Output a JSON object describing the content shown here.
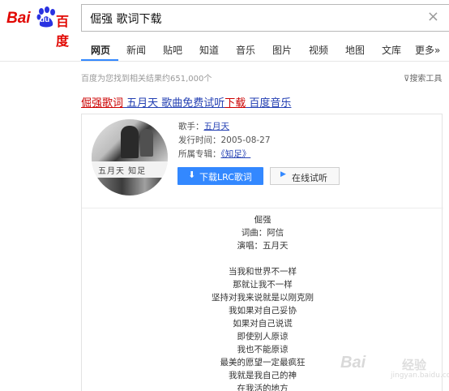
{
  "header": {
    "logo_text_left": "Bai",
    "logo_text_badge": "du",
    "logo_text_right": "百度",
    "search_query": "倔强 歌词下载",
    "clear_symbol": "×"
  },
  "nav": {
    "tabs": [
      {
        "label": "网页",
        "active": true
      },
      {
        "label": "新闻"
      },
      {
        "label": "贴吧"
      },
      {
        "label": "知道"
      },
      {
        "label": "音乐"
      },
      {
        "label": "图片"
      },
      {
        "label": "视频"
      },
      {
        "label": "地图"
      },
      {
        "label": "文库"
      },
      {
        "label": "更多»"
      }
    ]
  },
  "results": {
    "count_text": "百度为您找到相关结果约651,000个",
    "search_tools_label": "搜索工具",
    "first_result": {
      "title_before": "倔强歌词",
      "title_middle": " 五月天 歌曲免费试听",
      "title_highlight": "下载",
      "title_after": " 百度音乐"
    }
  },
  "song_card": {
    "cover_band_text": "五月天 知足",
    "singer_label": "歌手：",
    "singer_value": "五月天",
    "release_label": "发行时间：",
    "release_value": "2005-08-27",
    "album_label": "所属专辑：",
    "album_value": "《知足》",
    "download_button": "下载LRC歌词",
    "download_icon": "download-icon",
    "listen_button": "在线试听",
    "listen_icon": "play-icon"
  },
  "lyrics": [
    "倔强",
    "词曲：阿信",
    "演唱：五月天",
    "",
    "当我和世界不一样",
    "那就让我不一样",
    "坚持对我来说就是以刚克刚",
    "我如果对自己妥协",
    "如果对自己说谎",
    "即使别人原谅",
    "我也不能原谅",
    "最美的愿望一定最疯狂",
    "我就是我自己的神",
    "在我活的地方"
  ],
  "watermark": {
    "brand": "Bai",
    "brand_cn": "经验",
    "sub": "jingyan.baidu.com"
  },
  "colors": {
    "brand_red": "#e10601",
    "link_blue": "#2440b3",
    "accent_blue": "#3388ff"
  }
}
